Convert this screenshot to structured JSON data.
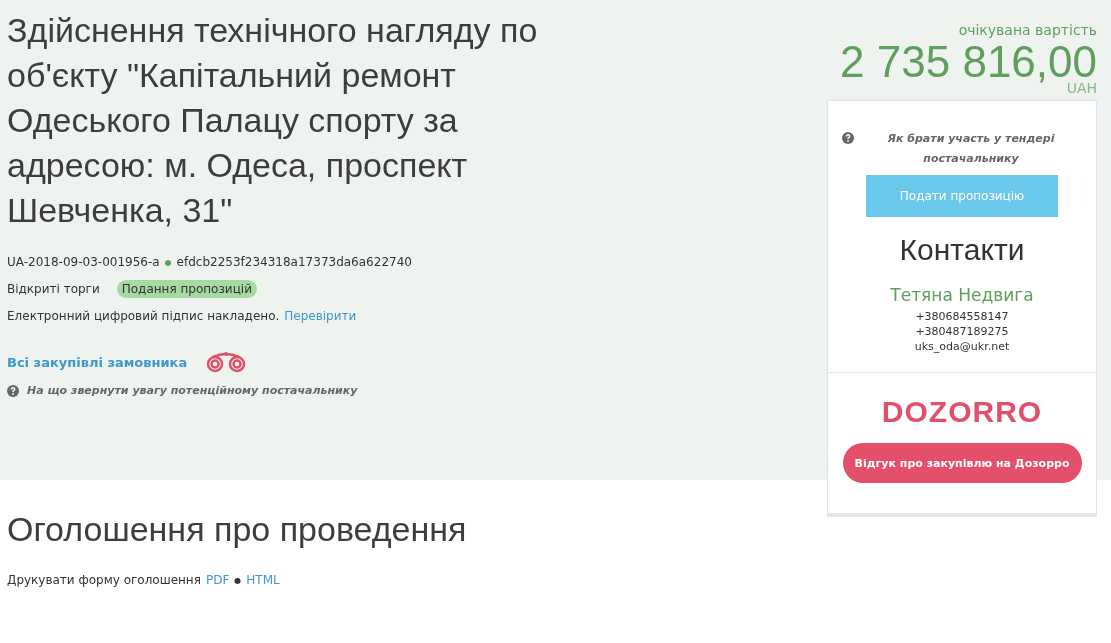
{
  "title": "Здійснення технічного нагляду по об'єкту \"Капітальний ремонт Одеського Палацу спорту за адресою: м. Одеса, проспект Шевченка, 31\"",
  "tender_id": "UA-2018-09-03-001956-a",
  "separator": "●",
  "hash": "efdcb2253f234318a17373da6a622740",
  "procedure": "Відкриті торги",
  "status": {
    "label": "Подання пропозицій",
    "color": "#a5dba0"
  },
  "signature": {
    "text": "Електронний цифровий підпис накладено.",
    "link": "Перевірити"
  },
  "buyer_link": "Всі закупівлі замовника",
  "hint": "На що звернути увагу потенційному постачальнику",
  "price": {
    "label": "очікувана вартість",
    "amount": "2 735 816,00",
    "currency": "UAH"
  },
  "card": {
    "help": "Як брати участь у тендері постачальнику",
    "submit": "Подати пропозицію",
    "contacts_title": "Контакти",
    "contact_name": "Тетяна Недвига",
    "phones": [
      "+380684558147",
      "+380487189275"
    ],
    "email": "uks_oda@ukr.net",
    "logo": "DOZORRO",
    "feedback": "Відгук про закупівлю на Дозорро"
  },
  "announcement": {
    "heading": "Оголошення про проведення",
    "print_label": "Друкувати форму оголошення",
    "formats": [
      "PDF",
      "HTML"
    ],
    "separator": "●"
  }
}
